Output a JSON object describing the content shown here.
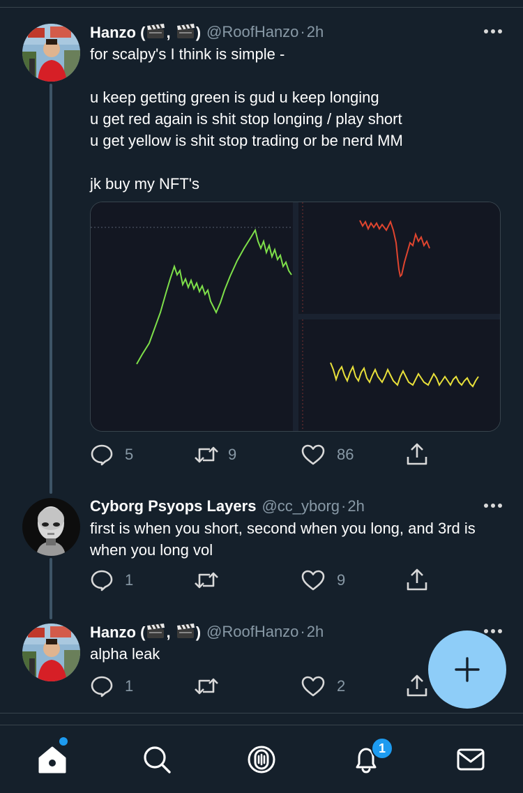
{
  "tweets": [
    {
      "name_prefix": "Hanzo (",
      "name_sep": ", ",
      "name_suffix": ")",
      "handle": "@RoofHanzo",
      "dot": "·",
      "time": "2h",
      "text": "for scalpy's I think is simple -\n\nu keep getting green is gud u keep longing\nu get red again is shit stop longing / play short\nu get yellow is shit stop trading or be nerd MM\n\njk buy my NFT's",
      "replies": "5",
      "retweets": "9",
      "likes": "86"
    },
    {
      "name": "Cyborg Psyops Layers",
      "handle": "@cc_yborg",
      "dot": "·",
      "time": "2h",
      "text": "first is when you short, second when you long, and 3rd is when you long vol",
      "replies": "1",
      "retweets": "",
      "likes": "9"
    },
    {
      "name_prefix": "Hanzo (",
      "name_sep": ", ",
      "name_suffix": ")",
      "handle": "@RoofHanzo",
      "dot": "·",
      "time": "2h",
      "text": "alpha leak",
      "replies": "1",
      "retweets": "",
      "likes": "2"
    }
  ],
  "icons": {
    "reply": "reply-icon",
    "retweet": "retweet-icon",
    "like": "heart-icon",
    "share": "share-icon",
    "more": "more-icon",
    "compose": "plus-icon",
    "home": "home-icon",
    "search": "search-icon",
    "spaces": "spaces-icon",
    "notifications": "bell-icon",
    "messages": "mail-icon",
    "emoji": "clapper-board-icon"
  },
  "tabbar": {
    "notifications_badge": "1"
  },
  "colors": {
    "background": "#15202b",
    "divider": "#38444d",
    "secondary_text": "#8899a6",
    "accent": "#1d9bf0",
    "fab": "#8ecdf8",
    "green_line": "#7ee04a",
    "red_line": "#e0452f",
    "yellow_line": "#e8e03a"
  }
}
